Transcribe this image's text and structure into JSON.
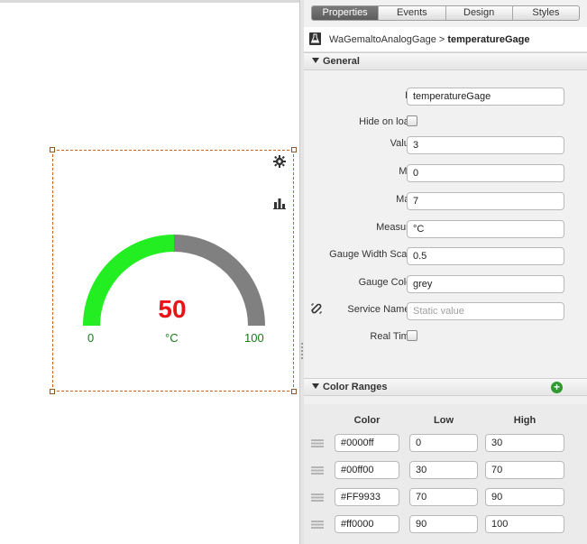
{
  "tabs": [
    "Properties",
    "Events",
    "Design",
    "Styles"
  ],
  "breadcrumb": {
    "parent": "WaGemaltoAnalogGage",
    "separator": " > ",
    "current": "temperatureGage"
  },
  "sections": {
    "general": "General",
    "color_ranges": "Color Ranges"
  },
  "gauge": {
    "value_display": "50",
    "min_label": "0",
    "max_label": "100",
    "unit_label": "°C",
    "filled_fraction": 0.5,
    "fill_color": "#22ee22",
    "track_color": "#808080",
    "value_color": "#e8141a",
    "label_color": "#1a7a1a"
  },
  "general": {
    "id_label": "ID:",
    "id_value": "temperatureGage",
    "hide_label": "Hide on load:",
    "value_label": "Value:",
    "value_value": "3",
    "min_label": "Min:",
    "min_value": "0",
    "max_label": "Max:",
    "max_value": "7",
    "measure_label": "Measure:",
    "measure_value": "°C",
    "width_label": "Gauge Width Scale:",
    "width_value": "0.5",
    "color_label": "Gauge Color:",
    "color_value": "grey",
    "service_label": "Service Names:",
    "service_placeholder": "Static value",
    "realtime_label": "Real Time:"
  },
  "color_ranges": {
    "headers": {
      "color": "Color",
      "low": "Low",
      "high": "High"
    },
    "rows": [
      {
        "color": "#0000ff",
        "low": "0",
        "high": "30"
      },
      {
        "color": "#00ff00",
        "low": "30",
        "high": "70"
      },
      {
        "color": "#FF9933",
        "low": "70",
        "high": "90"
      },
      {
        "color": "#ff0000",
        "low": "90",
        "high": "100"
      }
    ]
  },
  "icons": [
    "gear-icon",
    "bar-chart-icon",
    "flask-icon",
    "chevron-down-icon",
    "link-icon",
    "add-icon",
    "drag-handle-icon"
  ]
}
